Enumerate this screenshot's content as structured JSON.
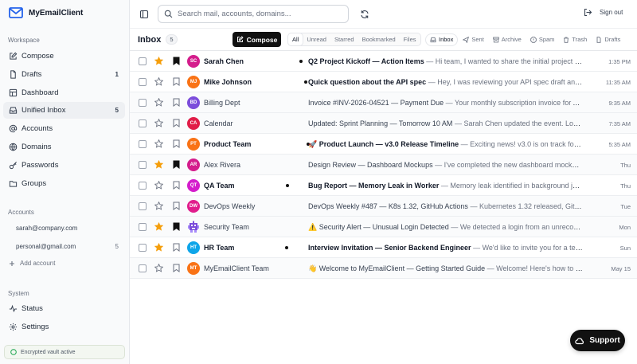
{
  "app": {
    "title": "MyEmailClient"
  },
  "sidebar": {
    "workspace_label": "Workspace",
    "items": [
      {
        "label": "Compose",
        "icon": "pencil-square-icon",
        "count": ""
      },
      {
        "label": "Drafts",
        "icon": "file-icon",
        "count": "1"
      },
      {
        "label": "Dashboard",
        "icon": "dashboard-icon",
        "count": ""
      },
      {
        "label": "Unified Inbox",
        "icon": "inbox-icon",
        "count": "5"
      },
      {
        "label": "Accounts",
        "icon": "at-sign-icon",
        "count": ""
      },
      {
        "label": "Domains",
        "icon": "globe-icon",
        "count": ""
      },
      {
        "label": "Passwords",
        "icon": "key-icon",
        "count": ""
      },
      {
        "label": "Groups",
        "icon": "folder-icon",
        "count": ""
      }
    ],
    "accounts_label": "Accounts",
    "accounts": [
      {
        "email": "sarah@company.com",
        "count": ""
      },
      {
        "email": "personal@gmail.com",
        "count": "5"
      }
    ],
    "add_account": "Add account",
    "system_label": "System",
    "system_items": [
      {
        "label": "Status",
        "icon": "activity-icon"
      },
      {
        "label": "Settings",
        "icon": "gear-icon"
      }
    ],
    "vault_status": "Encrypted vault active"
  },
  "topbar": {
    "search_placeholder": "Search mail, accounts, domains...",
    "sign_out": "Sign out"
  },
  "inbox": {
    "title": "Inbox",
    "count": "5",
    "compose_label": "Compose",
    "filters": [
      "All",
      "Unread",
      "Starred",
      "Bookmarked",
      "Files"
    ],
    "active_filter": "All",
    "folders": [
      {
        "label": "Inbox",
        "icon": "inbox-icon"
      },
      {
        "label": "Sent",
        "icon": "send-icon"
      },
      {
        "label": "Archive",
        "icon": "archive-icon"
      },
      {
        "label": "Spam",
        "icon": "spam-icon"
      },
      {
        "label": "Trash",
        "icon": "trash-icon"
      },
      {
        "label": "Drafts",
        "icon": "file-icon"
      }
    ],
    "active_folder": "Inbox"
  },
  "emails": [
    {
      "initials": "SC",
      "color": "#d41d8c",
      "sender": "Sarah Chen",
      "unread": true,
      "starred": true,
      "bookmarked": true,
      "subject": "Q2 Project Kickoff — Action Items",
      "preview": "Hi team, I wanted to share the initial project plan for the Q2 kickoff meeting",
      "time": "1:35 PM"
    },
    {
      "initials": "MJ",
      "color": "#f97316",
      "sender": "Mike Johnson",
      "unread": true,
      "starred": false,
      "bookmarked": false,
      "subject": "Quick question about the API spec",
      "preview": "Hey, I was reviewing your API spec draft and had a few questions",
      "time": "11:35 AM"
    },
    {
      "initials": "BD",
      "color": "#7c4ddb",
      "sender": "Billing Dept",
      "unread": false,
      "starred": false,
      "bookmarked": false,
      "subject": "Invoice #INV-2026-04521 — Payment Due",
      "preview": "Your monthly subscription invoice for April is ready",
      "time": "9:35 AM"
    },
    {
      "initials": "CA",
      "color": "#e11d48",
      "sender": "Calendar",
      "unread": false,
      "starred": false,
      "bookmarked": false,
      "subject": "Updated: Sprint Planning — Tomorrow 10 AM",
      "preview": "Sarah Chen updated the event. Location: Room 4B",
      "time": "7:35 AM"
    },
    {
      "initials": "PT",
      "color": "#f97316",
      "sender": "Product Team",
      "unread": true,
      "starred": false,
      "bookmarked": false,
      "subject": "🚀 Product Launch — v3.0 Release Timeline",
      "preview": "Exciting news! v3.0 is on track for June 1",
      "time": "5:35 AM"
    },
    {
      "initials": "AR",
      "color": "#d41d8c",
      "sender": "Alex Rivera",
      "unread": false,
      "starred": true,
      "bookmarked": true,
      "subject": "Design Review — Dashboard Mockups",
      "preview": "I've completed the new dashboard mockups. Key changes include",
      "time": "Thu"
    },
    {
      "initials": "QT",
      "color": "#d41dcc",
      "sender": "QA Team",
      "unread": true,
      "starred": false,
      "bookmarked": false,
      "subject": "Bug Report — Memory Leak in Worker",
      "preview": "Memory leak identified in background job processing",
      "time": "Thu"
    },
    {
      "initials": "DW",
      "color": "#e11d8c",
      "sender": "DevOps Weekly",
      "unread": false,
      "starred": false,
      "bookmarked": false,
      "subject": "DevOps Weekly #487 — K8s 1.32, GitHub Actions",
      "preview": "Kubernetes 1.32 released, GitHub Actions updates",
      "time": "Tue"
    },
    {
      "initials": "",
      "color": "#7c4ddb",
      "sender": "Security Team",
      "unread": false,
      "starred": true,
      "bookmarked": true,
      "subject": "⚠️ Security Alert — Unusual Login Detected",
      "preview": "We detected a login from an unrecognized device",
      "time": "Mon"
    },
    {
      "initials": "HT",
      "color": "#0ea5e9",
      "sender": "HR Team",
      "unread": true,
      "starred": true,
      "bookmarked": false,
      "subject": "Interview Invitation — Senior Backend Engineer",
      "preview": "We'd like to invite you for a technical interview",
      "time": "Sun"
    },
    {
      "initials": "MT",
      "color": "#f97316",
      "sender": "MyEmailClient Team",
      "unread": false,
      "starred": false,
      "bookmarked": false,
      "subject": "👋 Welcome to MyEmailClient — Getting Started Guide",
      "preview": "Welcome! Here's how to connect your first account",
      "time": "May 15"
    }
  ],
  "support": {
    "label": "Support"
  }
}
